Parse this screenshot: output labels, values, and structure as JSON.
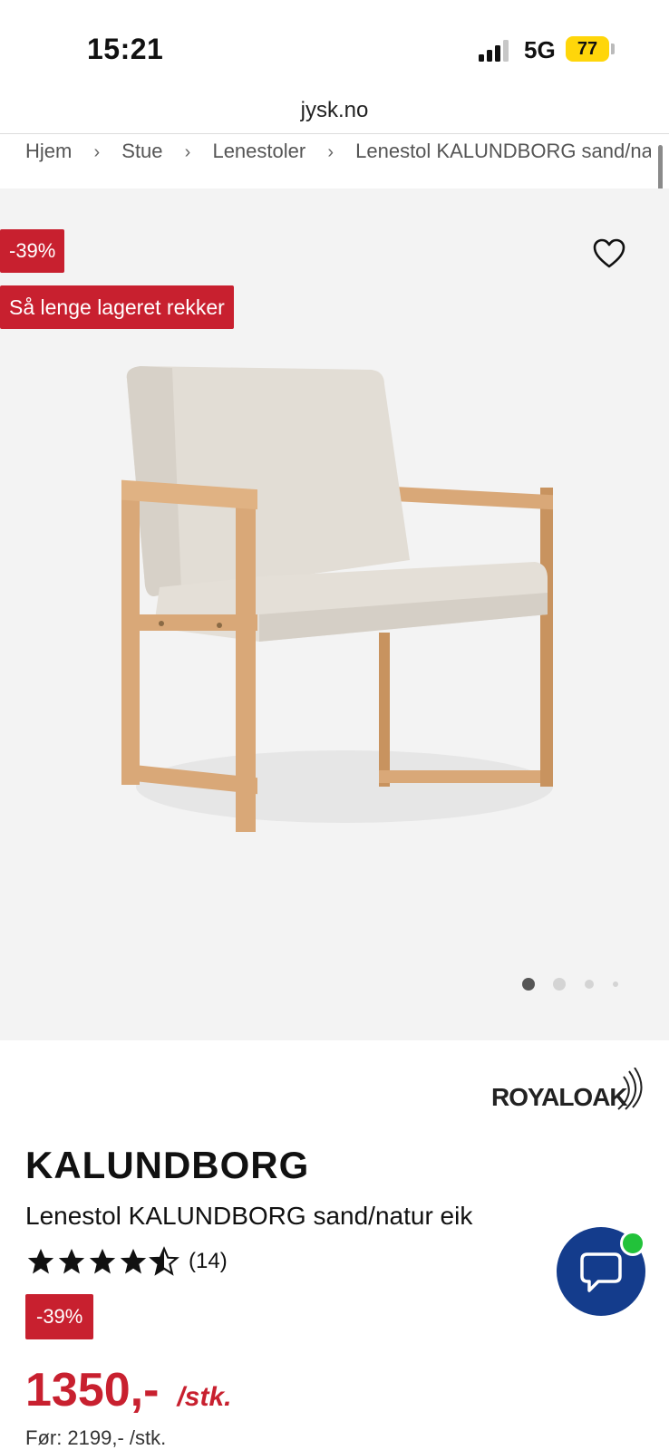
{
  "status_bar": {
    "time": "15:21",
    "network": "5G",
    "battery": "77"
  },
  "browser": {
    "url": "jysk.no"
  },
  "breadcrumb": [
    "Hjem",
    "Stue",
    "Lenestoler",
    "Lenestol KALUNDBORG sand/nat"
  ],
  "image": {
    "discount_badge": "-39%",
    "stock_badge": "Så lenge lageret rekker",
    "carousel": {
      "total": 4,
      "active": 1
    }
  },
  "product": {
    "brand": "ROYALOAK",
    "name": "KALUNDBORG",
    "description": "Lenestol KALUNDBORG sand/natur eik",
    "rating": 4.5,
    "rating_max": 5,
    "rating_count": "(14)",
    "discount_badge": "-39%",
    "price": "1350,-",
    "price_unit": "/stk.",
    "old_price": "Før: 2199,- /stk."
  },
  "colors": {
    "accent": "#c8202f",
    "chat": "#143c8c",
    "online": "#22c23a",
    "wood": "#d9a878",
    "fabric": "#e2ddd5"
  },
  "icons": {
    "favorite": "heart-icon",
    "chat": "chat-bubble-icon",
    "star": "star-icon"
  }
}
